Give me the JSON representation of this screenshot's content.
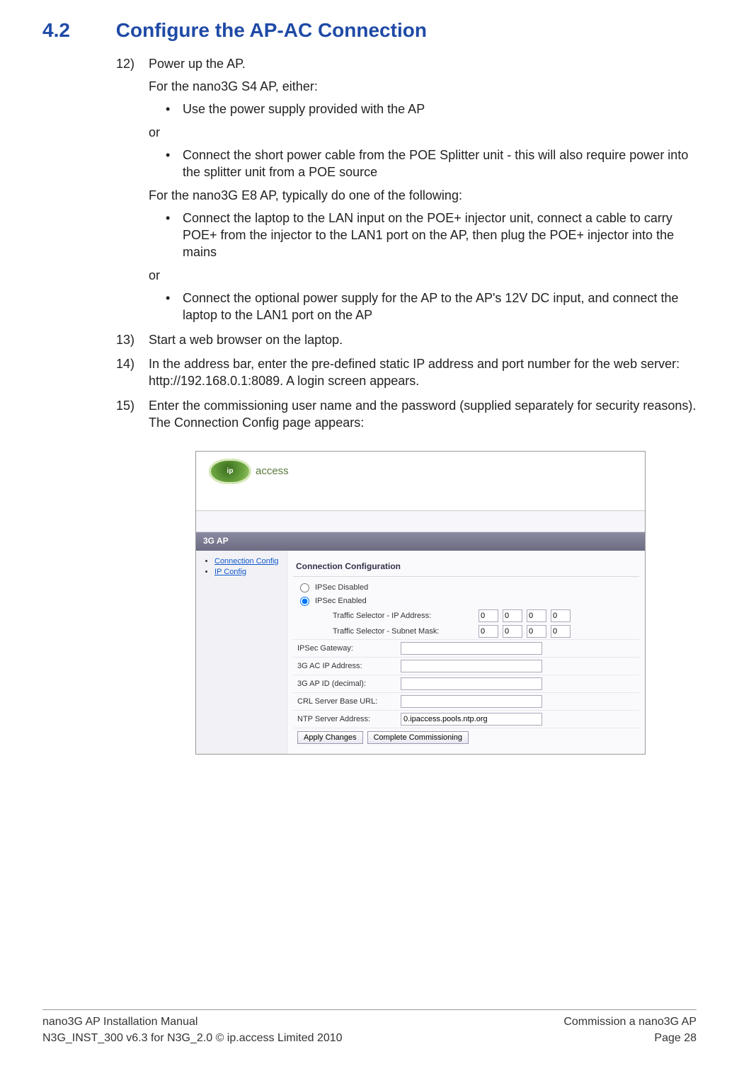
{
  "section": {
    "number": "4.2",
    "title": "Configure the AP-AC Connection"
  },
  "steps": {
    "s12": {
      "num": "12)",
      "lead": "Power up the AP.",
      "s4_intro": "For the nano3G S4 AP, either:",
      "s4_b1": "Use the power supply provided with the AP",
      "or1": "or",
      "s4_b2": "Connect the short power cable from the POE Splitter unit - this will also require power into the splitter unit from a POE source",
      "e8_intro": "For the nano3G E8 AP, typically do one of the following:",
      "e8_b1": "Connect the laptop to the LAN input on the POE+ injector unit, connect a cable to carry POE+ from the injector to the LAN1 port on the AP, then plug the POE+ injector into the mains",
      "or2": "or",
      "e8_b2": "Connect the optional power supply for the AP to the AP's 12V DC input, and connect the laptop to the LAN1 port on the AP"
    },
    "s13": {
      "num": "13)",
      "text": "Start a web browser on the laptop."
    },
    "s14": {
      "num": "14)",
      "text": "In the address bar, enter the pre-defined static IP address and port number for the web server: http://192.168.0.1:8089. A login screen appears."
    },
    "s15": {
      "num": "15)",
      "text": "Enter the commissioning user name and the password (supplied separately for security reasons). The Connection Config page appears:"
    }
  },
  "shot": {
    "logo_ip": "ip",
    "logo_access": "access",
    "tab_label": "3G AP",
    "side": {
      "link1": "Connection Config",
      "link2": "IP Config"
    },
    "panel_title": "Connection Configuration",
    "ipsec_disabled": "IPSec Disabled",
    "ipsec_enabled": "IPSec Enabled",
    "ts_ip_label": "Traffic Selector - IP Address:",
    "ts_mask_label": "Traffic Selector - Subnet Mask:",
    "oct": {
      "a1": "0",
      "a2": "0",
      "a3": "0",
      "a4": "0",
      "b1": "0",
      "b2": "0",
      "b3": "0",
      "b4": "0"
    },
    "fields": {
      "gateway": {
        "label": "IPSec Gateway:",
        "value": ""
      },
      "acip": {
        "label": "3G AC IP Address:",
        "value": ""
      },
      "apid": {
        "label": "3G AP ID (decimal):",
        "value": ""
      },
      "crl": {
        "label": "CRL Server Base URL:",
        "value": ""
      },
      "ntp": {
        "label": "NTP Server Address:",
        "value": "0.ipaccess.pools.ntp.org"
      }
    },
    "buttons": {
      "apply": "Apply Changes",
      "complete": "Complete Commissioning"
    }
  },
  "footer": {
    "left1": "nano3G AP Installation Manual",
    "left2": "N3G_INST_300 v6.3 for N3G_2.0 © ip.access Limited 2010",
    "right1": "Commission a nano3G AP",
    "right2": "Page 28"
  }
}
